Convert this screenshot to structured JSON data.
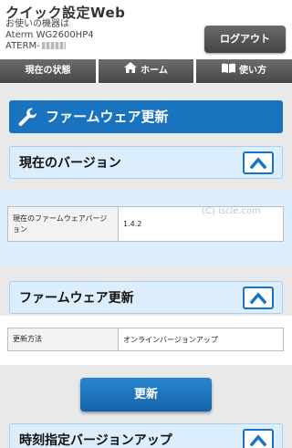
{
  "header": {
    "app_title": "クイック設定Web",
    "device_label": "お使いの機器は",
    "model": "Aterm WG2600HP4",
    "id_prefix": "ATERM-",
    "logout_label": "ログアウト"
  },
  "nav": {
    "status_label": "現在の状態",
    "home_label": "ホーム",
    "help_label": "使い方"
  },
  "page": {
    "title": "ファームウェア更新"
  },
  "current_version": {
    "heading": "現在のバージョン",
    "row_label": "現在のファームウェアバージョン",
    "row_value": "1.4.2"
  },
  "firmware_update": {
    "heading": "ファームウェア更新",
    "method_label": "更新方法",
    "method_value": "オンラインバージョンアップ",
    "button_label": "更新"
  },
  "scheduled_update": {
    "heading": "時刻指定バージョンアップ"
  },
  "watermark": "(C) iscle.com",
  "colors": {
    "accent": "#1a73be",
    "section_bg": "#dcedfb",
    "section_border": "#a9d1f3",
    "nav_bg": "#555555"
  },
  "icons": {
    "title": "wrench-icon",
    "home": "home-icon",
    "help": "book-icon",
    "collapse": "chevron-up-icon"
  }
}
